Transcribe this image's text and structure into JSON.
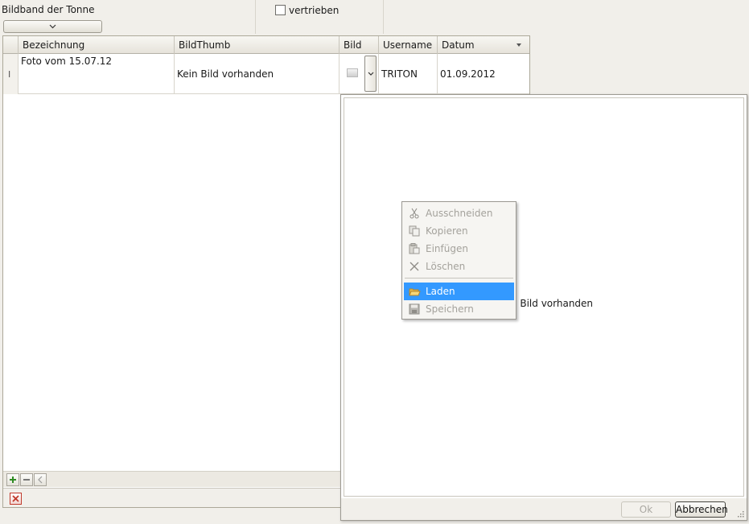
{
  "form": {
    "group_label": "Bildband der Tonne",
    "checkbox_label": "vertrieben"
  },
  "grid": {
    "columns": [
      "Bezeichnung",
      "BildThumb",
      "Bild",
      "Username",
      "Datum"
    ],
    "rows": [
      {
        "bezeichnung": "Foto vom 15.07.12",
        "bildthumb": "Kein Bild vorhanden",
        "username": "TRITON",
        "datum": "01.09.2012"
      }
    ]
  },
  "popup": {
    "placeholder": "Kein Bild vorhanden",
    "ok_label": "Ok",
    "cancel_label": "Abbrechen"
  },
  "context_menu": {
    "items": [
      {
        "label": "Ausschneiden",
        "icon": "scissors-icon",
        "enabled": false
      },
      {
        "label": "Kopieren",
        "icon": "copy-icon",
        "enabled": false
      },
      {
        "label": "Einfügen",
        "icon": "paste-icon",
        "enabled": false
      },
      {
        "label": "Löschen",
        "icon": "delete-icon",
        "enabled": false
      },
      {
        "label": "Laden",
        "icon": "folder-open-icon",
        "enabled": true,
        "highlighted": true
      },
      {
        "label": "Speichern",
        "icon": "save-icon",
        "enabled": false
      }
    ]
  },
  "colors": {
    "highlight": "#3399ff",
    "window_bg": "#f1efea",
    "disabled_text": "#a4a29c"
  }
}
